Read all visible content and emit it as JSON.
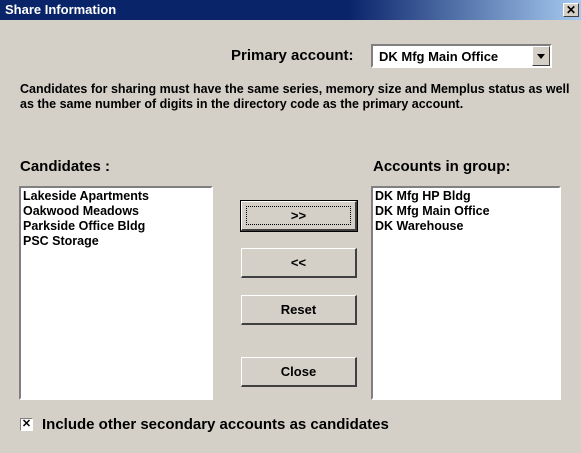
{
  "window": {
    "title": "Share Information",
    "close_glyph": "✕"
  },
  "primary_account": {
    "label": "Primary account:",
    "value": "DK Mfg Main Office"
  },
  "description": "Candidates for sharing must have the same series, memory size and  Memplus status as well as the same number of digits in the directory code as the primary account.",
  "candidates": {
    "label": "Candidates :",
    "items": [
      "Lakeside Apartments",
      "Oakwood Meadows",
      "Parkside Office Bldg",
      "PSC Storage"
    ]
  },
  "group": {
    "label": "Accounts in group:",
    "items": [
      "DK Mfg HP Bldg",
      "DK Mfg Main Office",
      "DK Warehouse"
    ]
  },
  "buttons": {
    "add": ">>",
    "remove": "<<",
    "reset": "Reset",
    "close": "Close"
  },
  "option": {
    "label": "Include other secondary accounts as candidates",
    "checked": true,
    "check_glyph": "✕"
  }
}
